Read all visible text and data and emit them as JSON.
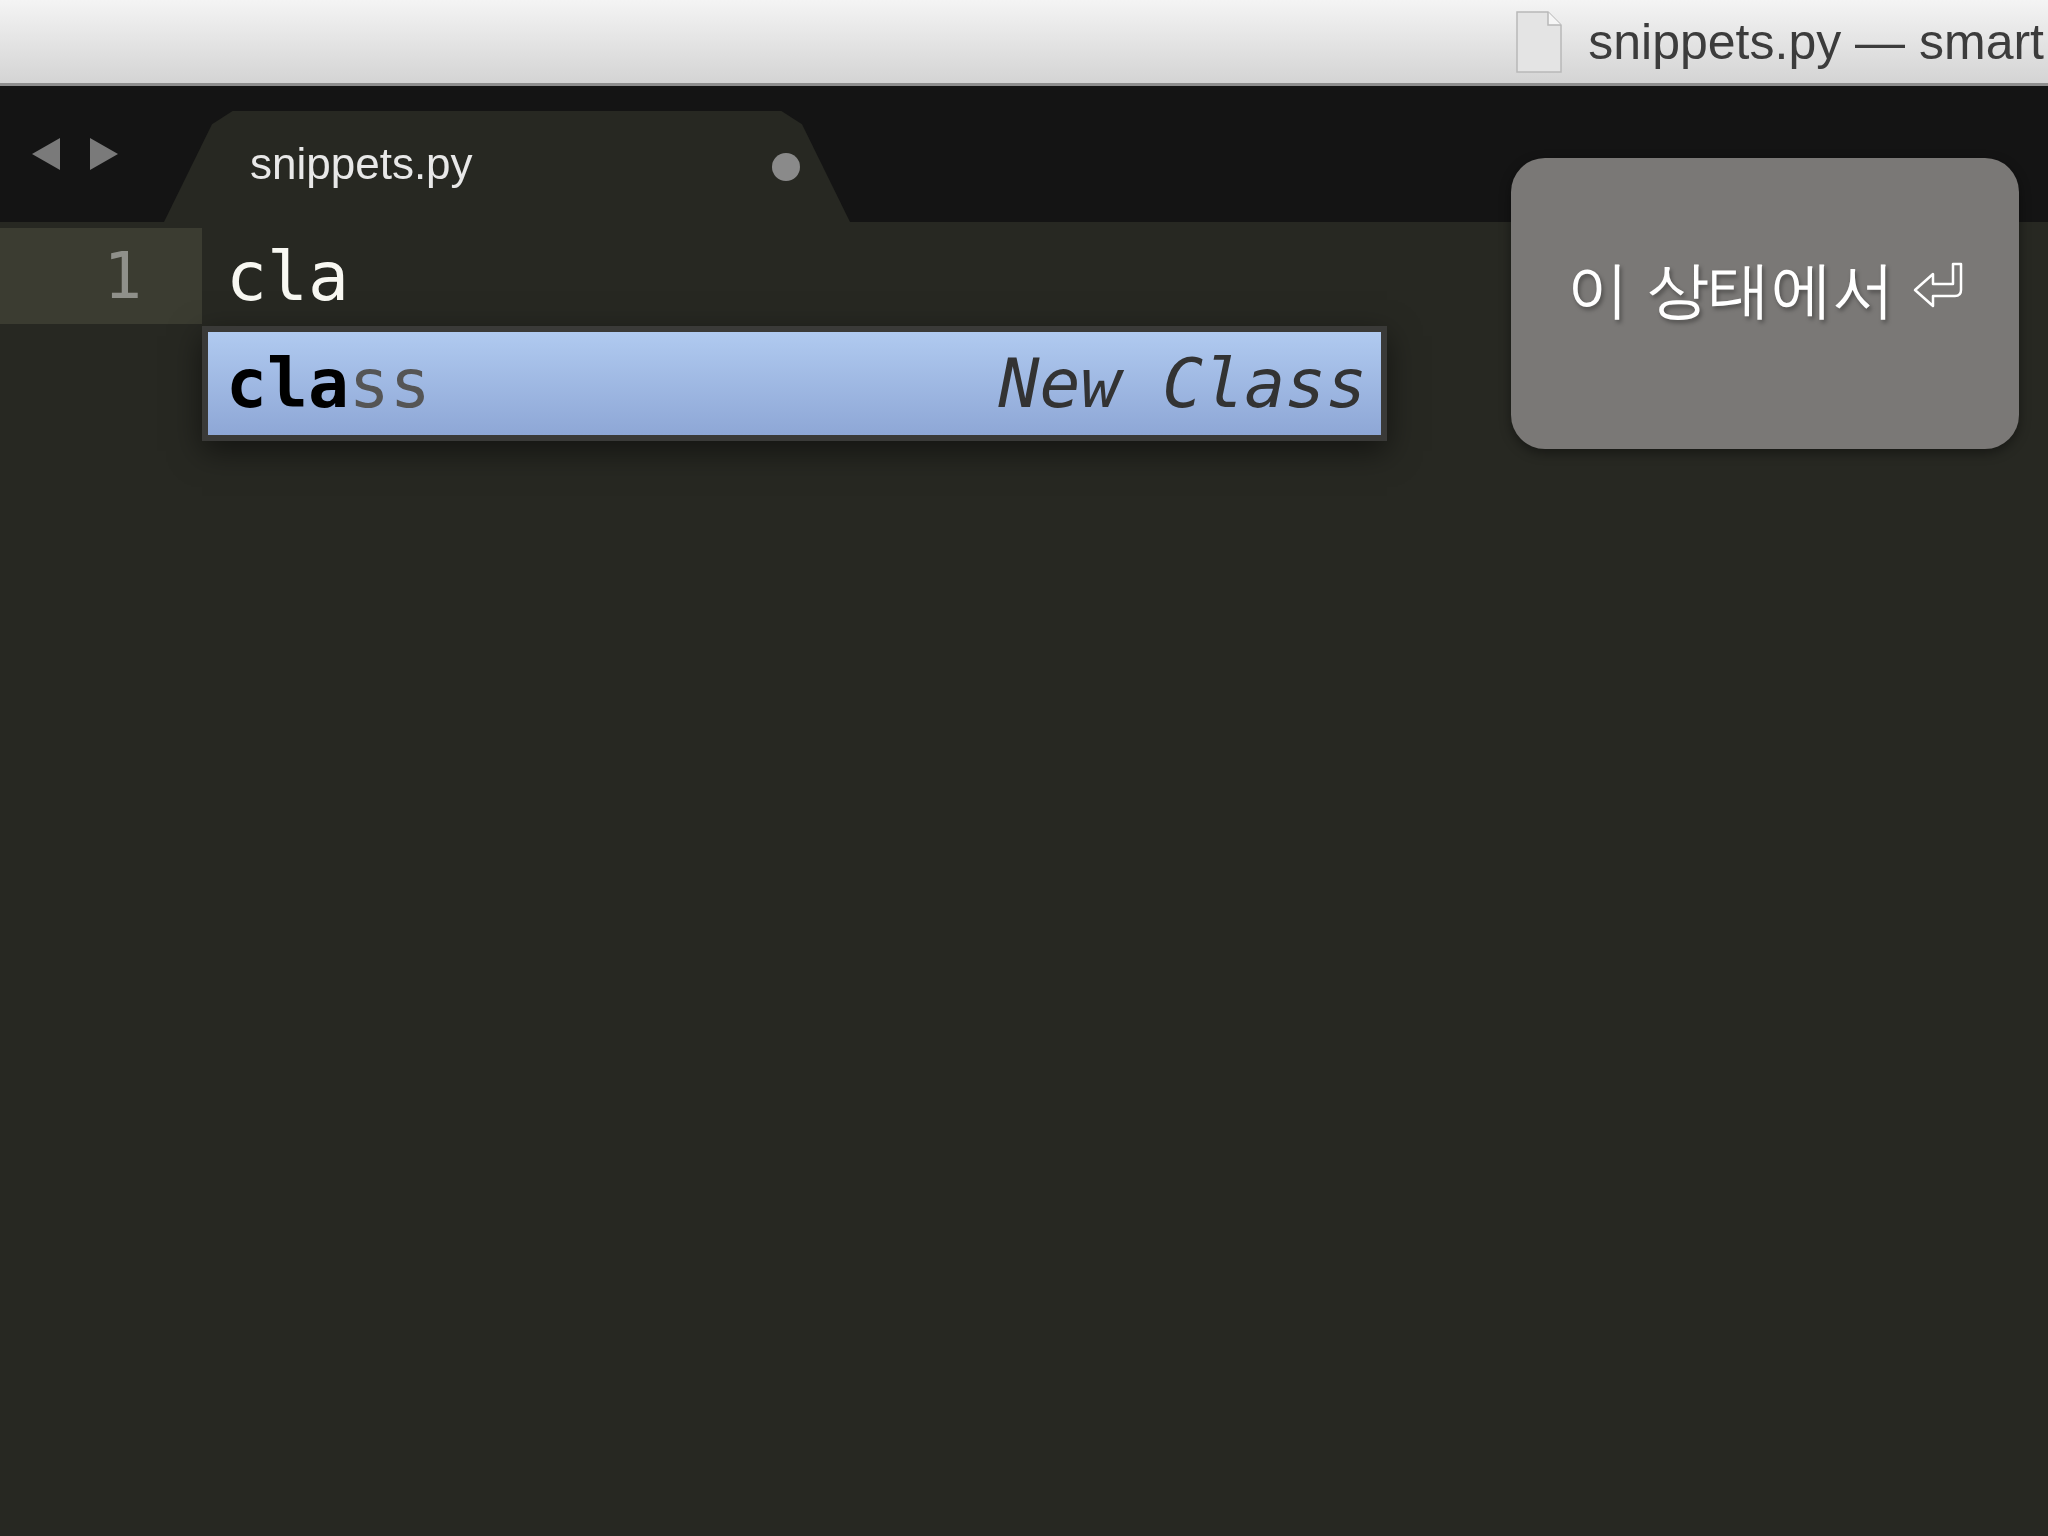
{
  "window": {
    "title": "snippets.py — smart"
  },
  "tabs": [
    {
      "label": "snippets.py",
      "selected": true,
      "modified": true
    }
  ],
  "editor": {
    "lines": [
      {
        "number": "1",
        "text": "cla",
        "current": true
      }
    ]
  },
  "autocomplete": {
    "items": [
      {
        "trigger": "**cla**ss",
        "description": "New Class",
        "selected": true
      }
    ]
  },
  "annotation": {
    "text": "이 상태에서"
  }
}
